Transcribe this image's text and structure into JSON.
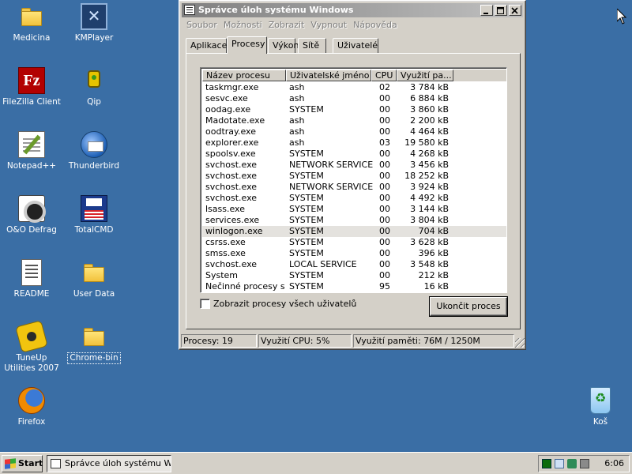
{
  "desktop": {
    "icons": [
      {
        "label": "Medicina",
        "icon": "folder-icon"
      },
      {
        "label": "KMPlayer",
        "icon": "kmplayer-icon"
      },
      {
        "label": "FileZilla Client",
        "icon": "filezilla-icon"
      },
      {
        "label": "Qip",
        "icon": "qip-icon"
      },
      {
        "label": "Notepad++",
        "icon": "notepad-icon"
      },
      {
        "label": "Thunderbird",
        "icon": "thunderbird-icon"
      },
      {
        "label": "O&O Defrag",
        "icon": "defrag-icon"
      },
      {
        "label": "TotalCMD",
        "icon": "totalcmd-icon"
      },
      {
        "label": "README",
        "icon": "document-icon"
      },
      {
        "label": "User Data",
        "icon": "folder-icon"
      },
      {
        "label": "TuneUp Utilities 2007",
        "icon": "tuneup-icon"
      },
      {
        "label": "Chrome-bin",
        "icon": "folder-icon"
      },
      {
        "label": "Firefox",
        "icon": "firefox-icon"
      },
      {
        "label": "Koš",
        "icon": "recycle-bin-icon"
      }
    ]
  },
  "window": {
    "title": "Správce úloh systému Windows",
    "menu": [
      "Soubor",
      "Možnosti",
      "Zobrazit",
      "Vypnout",
      "Nápověda"
    ],
    "tabs": [
      "Aplikace",
      "Procesy",
      "Výkon",
      "Sítě",
      "Uživatelé"
    ],
    "active_tab": "Procesy",
    "columns": [
      "Název procesu",
      "Uživatelské jméno",
      "CPU",
      "Využití pa..."
    ],
    "processes": [
      {
        "name": "taskmgr.exe",
        "user": "ash",
        "cpu": "02",
        "mem": "3 784 kB"
      },
      {
        "name": "sesvc.exe",
        "user": "ash",
        "cpu": "00",
        "mem": "6 884 kB"
      },
      {
        "name": "oodag.exe",
        "user": "SYSTEM",
        "cpu": "00",
        "mem": "3 860 kB"
      },
      {
        "name": "Madotate.exe",
        "user": "ash",
        "cpu": "00",
        "mem": "2 200 kB"
      },
      {
        "name": "oodtray.exe",
        "user": "ash",
        "cpu": "00",
        "mem": "4 464 kB"
      },
      {
        "name": "explorer.exe",
        "user": "ash",
        "cpu": "03",
        "mem": "19 580 kB"
      },
      {
        "name": "spoolsv.exe",
        "user": "SYSTEM",
        "cpu": "00",
        "mem": "4 268 kB"
      },
      {
        "name": "svchost.exe",
        "user": "NETWORK SERVICE",
        "cpu": "00",
        "mem": "3 456 kB"
      },
      {
        "name": "svchost.exe",
        "user": "SYSTEM",
        "cpu": "00",
        "mem": "18 252 kB"
      },
      {
        "name": "svchost.exe",
        "user": "NETWORK SERVICE",
        "cpu": "00",
        "mem": "3 924 kB"
      },
      {
        "name": "svchost.exe",
        "user": "SYSTEM",
        "cpu": "00",
        "mem": "4 492 kB"
      },
      {
        "name": "lsass.exe",
        "user": "SYSTEM",
        "cpu": "00",
        "mem": "3 144 kB"
      },
      {
        "name": "services.exe",
        "user": "SYSTEM",
        "cpu": "00",
        "mem": "3 804 kB"
      },
      {
        "name": "winlogon.exe",
        "user": "SYSTEM",
        "cpu": "00",
        "mem": "704 kB",
        "selected": true
      },
      {
        "name": "csrss.exe",
        "user": "SYSTEM",
        "cpu": "00",
        "mem": "3 628 kB"
      },
      {
        "name": "smss.exe",
        "user": "SYSTEM",
        "cpu": "00",
        "mem": "396 kB"
      },
      {
        "name": "svchost.exe",
        "user": "LOCAL SERVICE",
        "cpu": "00",
        "mem": "3 548 kB"
      },
      {
        "name": "System",
        "user": "SYSTEM",
        "cpu": "00",
        "mem": "212 kB"
      },
      {
        "name": "Nečinné procesy s...",
        "user": "SYSTEM",
        "cpu": "95",
        "mem": "16 kB"
      }
    ],
    "show_all_users_label": "Zobrazit procesy všech uživatelů",
    "show_all_users_checked": false,
    "end_process_label": "Ukončit proces",
    "status": {
      "processes": "Procesy: 19",
      "cpu": "Využití CPU: 5%",
      "memory": "Využití paměti: 76M / 1250M"
    }
  },
  "taskbar": {
    "start_label": "Start",
    "task_button_label": "Správce úloh systému Wi...",
    "clock": "6:06"
  },
  "colors": {
    "desktop": "#3a6ea5",
    "chrome": "#d4d0c8",
    "inactive_title_start": "#808080",
    "inactive_title_end": "#c0c0c0"
  }
}
